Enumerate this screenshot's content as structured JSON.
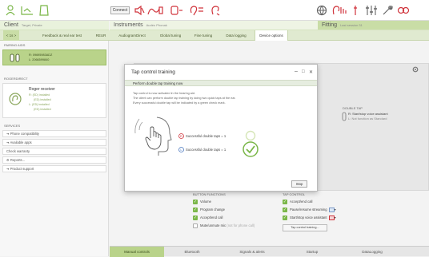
{
  "toolbar": {
    "connect_label": "Connect"
  },
  "sections": {
    "client": {
      "label": "Client",
      "sub": "Target, Private"
    },
    "instruments": {
      "label": "Instruments",
      "sub": "Audéo Phonak"
    },
    "fitting": {
      "label": "Fitting",
      "sub": "Last session 31"
    }
  },
  "tabs": [
    {
      "label": "< 1s >"
    },
    {
      "label": "Feedback & real ear test"
    },
    {
      "label": "REUR"
    },
    {
      "label": "AudiogramDirect"
    },
    {
      "label": "Global tuning"
    },
    {
      "label": "Fine tuning"
    },
    {
      "label": "Data logging"
    },
    {
      "label": "Device options"
    }
  ],
  "left": {
    "pairing_label": "PAIRING AIDS",
    "pair_lines": [
      "R: 09695983ADZ",
      "L: 2066599840"
    ],
    "remote_label": "ROGERDIRECT",
    "rec_title": "Roger receiver",
    "rec_lines": [
      "R: (ED) installed",
      "(ED) installed",
      "L: (ED) installed",
      "(ED) installed"
    ],
    "services_label": "SERVICES",
    "services": [
      "Phone compatibility",
      "Available apps",
      "Check warranty",
      "Reports...",
      "Product support"
    ]
  },
  "double_tap": {
    "label": "DOUBLE TAP",
    "line1": "R: Start/stop voice assistant",
    "line2": "L: Not function as Standard"
  },
  "button_functions": {
    "label": "BUTTON FUNCTIONS",
    "items": [
      {
        "label": "Volume",
        "checked": true
      },
      {
        "label": "Program change",
        "checked": true
      },
      {
        "label": "Accept/end call",
        "checked": true
      },
      {
        "label": "Mute/unmute mic",
        "note": "(not for phone call)",
        "checked": false
      }
    ]
  },
  "tap_control": {
    "label": "TAP CONTROL",
    "items": [
      {
        "label": "Accept/end call",
        "checked": true
      },
      {
        "label": "Pause/resume streaming",
        "checked": true
      },
      {
        "label": "Start/stop voice assistant",
        "checked": true
      }
    ],
    "training_button": "Tap control training..."
  },
  "bottom_tabs": [
    "Manual controls",
    "Bluetooth",
    "Signals & alerts",
    "Startup",
    "DataLogging"
  ],
  "modal": {
    "title": "Tap control training",
    "minimize": "–",
    "maximize": "□",
    "close": "✕",
    "subtitle": "Perform double tap training now",
    "text_lines": [
      "Tap control is now activated in the hearing aid.",
      "The client can perform double tap training by doing two quick taps at the ear.",
      "Every successful double tap will be indicated by a green check mark."
    ],
    "row1": "Successful double taps = 1",
    "row2": "Successful double taps = 1",
    "stop_label": "Stop"
  },
  "colors": {
    "accent_green": "#7ab648",
    "header_green": "#e9f2dc",
    "pair_green": "#b9d38a",
    "alert_red": "#d0343c"
  }
}
